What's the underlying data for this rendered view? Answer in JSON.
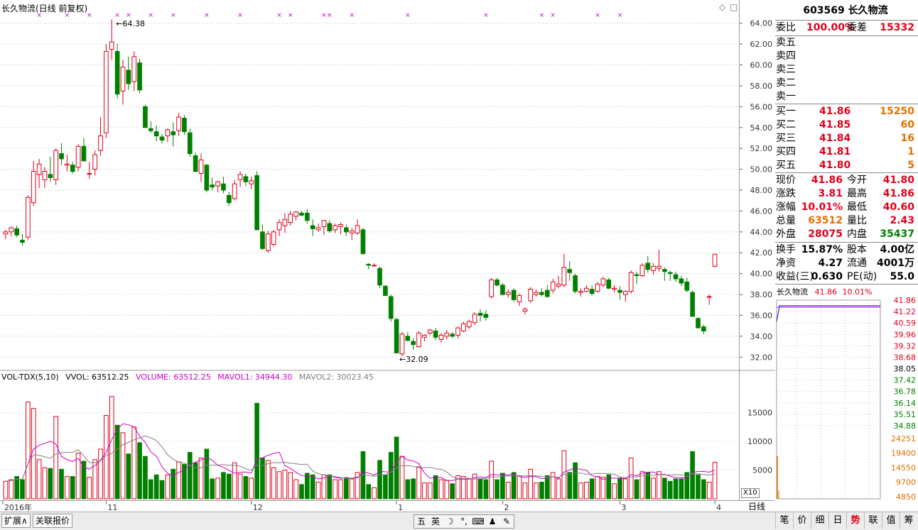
{
  "chart_title": "长久物流(日线 前复权)",
  "price_axis_labels": [
    "64.00",
    "62.00",
    "60.00",
    "58.00",
    "56.00",
    "54.00",
    "52.00",
    "50.00",
    "48.00",
    "46.00",
    "44.00",
    "42.00",
    "40.00",
    "38.00",
    "36.00",
    "34.00",
    "32.00"
  ],
  "vol_axis_labels": [
    "15000",
    "10000",
    "5000"
  ],
  "vol_header": {
    "name": "VOL-TDX(5,10)",
    "vvol": "VVOL: 63512.25",
    "volume": "VOLUME: 63512.25",
    "mavol1": "MAVOL1: 34944.30",
    "mavol2": "MAVOL2: 30023.45"
  },
  "vol_scale_label": "X10",
  "date_labels": [
    "2016年",
    "11",
    "12",
    "1",
    "2",
    "3",
    "4"
  ],
  "period_label": "日线",
  "annotations": {
    "high": "64.38",
    "low": "32.09"
  },
  "colors": {
    "up": "#e0001a",
    "down": "#008000",
    "ma1": "#cc00cc",
    "ma2": "#808080",
    "marker": "#cc00cc"
  },
  "chart_data": {
    "type": "candlestick",
    "title": "长久物流(日线 前复权)",
    "ylim": [
      31,
      65
    ],
    "candles": [
      [
        43.8,
        44.2,
        43.3,
        44.0
      ],
      [
        44.0,
        44.5,
        43.6,
        44.4
      ],
      [
        44.3,
        44.6,
        43.5,
        43.7
      ],
      [
        43.2,
        43.8,
        42.7,
        43.0
      ],
      [
        43.5,
        47.5,
        43.2,
        47.3
      ],
      [
        46.8,
        50.8,
        46.5,
        49.8
      ],
      [
        49.5,
        51.0,
        48.2,
        50.5
      ],
      [
        49.0,
        50.2,
        48.2,
        49.8
      ],
      [
        49.5,
        51.2,
        48.8,
        49.2
      ],
      [
        49.0,
        52.0,
        48.5,
        51.8
      ],
      [
        51.5,
        52.5,
        50.4,
        51.0
      ],
      [
        50.4,
        51.4,
        49.8,
        50.5
      ],
      [
        50.4,
        50.7,
        49.6,
        49.8
      ],
      [
        50.2,
        52.4,
        49.8,
        52.2
      ],
      [
        52.2,
        53.0,
        50.8,
        50.8
      ],
      [
        49.6,
        50.7,
        49.1,
        49.6
      ],
      [
        50.0,
        51.8,
        49.4,
        51.4
      ],
      [
        51.8,
        55.0,
        51.3,
        53.2
      ],
      [
        53.5,
        62.0,
        53.0,
        61.3
      ],
      [
        61.5,
        64.38,
        60.5,
        62.2
      ],
      [
        61.3,
        62.0,
        56.8,
        57.2
      ],
      [
        57.5,
        60.5,
        56.2,
        59.8
      ],
      [
        59.5,
        60.8,
        57.6,
        58.2
      ],
      [
        58.4,
        61.3,
        57.5,
        60.8
      ],
      [
        60.2,
        60.6,
        57.3,
        57.6
      ],
      [
        56.0,
        56.2,
        54.0,
        54.0
      ],
      [
        53.9,
        54.6,
        53.5,
        53.7
      ],
      [
        53.6,
        54.2,
        52.7,
        53.2
      ],
      [
        53.1,
        53.4,
        52.5,
        52.8
      ],
      [
        53.2,
        53.9,
        52.6,
        53.8
      ],
      [
        53.6,
        54.5,
        52.2,
        53.3
      ],
      [
        53.7,
        55.4,
        53.2,
        55.0
      ],
      [
        54.9,
        55.2,
        53.3,
        53.6
      ],
      [
        53.5,
        53.9,
        51.2,
        51.5
      ],
      [
        51.3,
        51.6,
        49.7,
        49.8
      ],
      [
        49.6,
        51.5,
        48.8,
        50.9
      ],
      [
        50.4,
        50.5,
        47.8,
        48.0
      ],
      [
        48.5,
        49.2,
        48.0,
        48.3
      ],
      [
        48.4,
        48.9,
        47.8,
        48.8
      ],
      [
        48.6,
        49.3,
        47.7,
        48.0
      ],
      [
        47.5,
        47.8,
        46.5,
        46.8
      ],
      [
        47.2,
        49.0,
        47.0,
        48.6
      ],
      [
        49.0,
        49.8,
        48.3,
        49.5
      ],
      [
        49.3,
        49.6,
        48.4,
        48.8
      ],
      [
        48.6,
        49.3,
        48.1,
        48.9
      ],
      [
        49.4,
        49.8,
        44.2,
        44.2
      ],
      [
        44.0,
        44.7,
        42.3,
        42.4
      ],
      [
        42.2,
        44.1,
        42.0,
        43.8
      ],
      [
        42.8,
        44.2,
        42.6,
        44.0
      ],
      [
        44.2,
        45.2,
        43.6,
        44.9
      ],
      [
        44.6,
        45.8,
        43.9,
        45.2
      ],
      [
        44.9,
        46.0,
        44.6,
        45.7
      ],
      [
        45.5,
        46.0,
        45.1,
        45.9
      ],
      [
        45.8,
        46.0,
        45.5,
        45.6
      ],
      [
        45.8,
        46.2,
        44.8,
        45.1
      ],
      [
        44.6,
        45.2,
        43.6,
        44.3
      ],
      [
        44.2,
        44.8,
        44.0,
        44.4
      ],
      [
        44.5,
        45.0,
        43.7,
        45.1
      ],
      [
        44.8,
        45.1,
        43.9,
        44.1
      ],
      [
        44.2,
        44.8,
        43.9,
        44.6
      ],
      [
        44.5,
        44.9,
        43.8,
        44.7
      ],
      [
        44.4,
        44.7,
        43.6,
        44.0
      ],
      [
        43.9,
        44.4,
        43.2,
        44.1
      ],
      [
        43.9,
        45.2,
        43.7,
        44.6
      ],
      [
        44.2,
        44.4,
        41.9,
        41.9
      ],
      [
        40.9,
        41.0,
        40.4,
        40.8
      ],
      [
        40.8,
        41.0,
        40.7,
        40.8
      ],
      [
        40.5,
        40.7,
        38.6,
        38.9
      ],
      [
        38.8,
        38.9,
        37.9,
        37.9
      ],
      [
        37.8,
        38.0,
        35.4,
        35.7
      ],
      [
        35.6,
        35.8,
        32.4,
        32.4
      ],
      [
        32.3,
        34.4,
        32.09,
        34.2
      ],
      [
        34.0,
        34.4,
        33.5,
        33.6
      ],
      [
        33.5,
        33.8,
        32.7,
        33.2
      ],
      [
        33.0,
        34.5,
        32.9,
        34.3
      ],
      [
        33.9,
        34.2,
        33.5,
        34.1
      ],
      [
        34.3,
        34.7,
        34.1,
        34.6
      ],
      [
        34.5,
        34.8,
        33.6,
        33.9
      ],
      [
        33.7,
        34.3,
        33.4,
        34.1
      ],
      [
        34.0,
        34.6,
        33.7,
        34.3
      ],
      [
        34.2,
        34.4,
        33.8,
        34.0
      ],
      [
        34.1,
        34.9,
        33.8,
        34.8
      ],
      [
        34.5,
        35.4,
        34.4,
        35.2
      ],
      [
        34.9,
        35.6,
        34.7,
        35.4
      ],
      [
        35.3,
        36.3,
        35.1,
        36.1
      ],
      [
        36.2,
        36.6,
        35.4,
        36.0
      ],
      [
        36.1,
        36.5,
        35.5,
        35.8
      ],
      [
        37.8,
        39.6,
        37.6,
        39.4
      ],
      [
        39.4,
        39.6,
        38.8,
        38.9
      ],
      [
        38.9,
        39.1,
        37.9,
        38.0
      ],
      [
        38.0,
        38.5,
        37.7,
        38.2
      ],
      [
        38.4,
        38.6,
        37.3,
        37.5
      ],
      [
        37.3,
        38.1,
        36.9,
        37.9
      ],
      [
        36.4,
        36.8,
        36.1,
        36.6
      ],
      [
        37.4,
        38.7,
        37.2,
        38.5
      ],
      [
        38.0,
        38.5,
        37.8,
        38.2
      ],
      [
        38.2,
        38.6,
        37.8,
        38.0
      ],
      [
        38.4,
        38.9,
        37.7,
        37.8
      ],
      [
        38.4,
        39.5,
        38.1,
        39.2
      ],
      [
        38.8,
        39.8,
        38.6,
        39.0
      ],
      [
        38.9,
        41.9,
        38.7,
        40.6
      ],
      [
        40.4,
        41.2,
        39.3,
        40.1
      ],
      [
        39.8,
        40.0,
        38.1,
        38.3
      ],
      [
        38.2,
        38.6,
        37.8,
        38.3
      ],
      [
        38.3,
        38.9,
        38.2,
        38.6
      ],
      [
        38.5,
        38.9,
        37.9,
        38.1
      ],
      [
        38.3,
        39.2,
        38.2,
        39.0
      ],
      [
        38.9,
        39.7,
        38.7,
        39.5
      ],
      [
        39.4,
        39.6,
        38.5,
        38.6
      ],
      [
        38.5,
        38.9,
        38.2,
        38.6
      ],
      [
        38.4,
        38.8,
        37.5,
        38.2
      ],
      [
        38.0,
        38.4,
        37.3,
        38.3
      ],
      [
        38.3,
        40.3,
        38.1,
        40.1
      ],
      [
        39.9,
        40.2,
        39.0,
        39.8
      ],
      [
        39.8,
        41.0,
        39.7,
        40.8
      ],
      [
        41.0,
        41.7,
        40.1,
        40.4
      ],
      [
        40.3,
        41.0,
        39.9,
        40.7
      ],
      [
        40.5,
        42.3,
        40.2,
        40.7
      ],
      [
        40.4,
        40.6,
        39.3,
        40.2
      ],
      [
        40.1,
        40.3,
        39.3,
        40.0
      ],
      [
        39.9,
        40.2,
        39.2,
        39.5
      ],
      [
        39.5,
        39.8,
        38.8,
        39.1
      ],
      [
        39.2,
        39.6,
        38.2,
        38.4
      ],
      [
        38.2,
        38.4,
        35.9,
        35.9
      ],
      [
        35.7,
        35.8,
        34.8,
        34.8
      ],
      [
        34.9,
        35.1,
        34.2,
        34.5
      ],
      [
        37.8,
        38.0,
        37.0,
        37.8
      ],
      [
        40.7,
        41.86,
        40.6,
        41.86
      ]
    ]
  },
  "quote": {
    "code_name": "603569 长久物流",
    "weibi_label": "委比",
    "weibi_value": "100.00%",
    "weicha_label": "委差",
    "weicha_value": "15332",
    "sells": [
      {
        "label": "卖五",
        "price": "",
        "vol": ""
      },
      {
        "label": "卖四",
        "price": "",
        "vol": ""
      },
      {
        "label": "卖三",
        "price": "",
        "vol": ""
      },
      {
        "label": "卖二",
        "price": "",
        "vol": ""
      },
      {
        "label": "卖一",
        "price": "",
        "vol": ""
      }
    ],
    "buys": [
      {
        "label": "买一",
        "price": "41.86",
        "vol": "15250"
      },
      {
        "label": "买二",
        "price": "41.85",
        "vol": "60"
      },
      {
        "label": "买三",
        "price": "41.84",
        "vol": "16"
      },
      {
        "label": "买四",
        "price": "41.81",
        "vol": "1"
      },
      {
        "label": "买五",
        "price": "41.80",
        "vol": "5"
      }
    ],
    "stats": [
      {
        "l1": "现价",
        "v1": "41.86",
        "c1": "red",
        "l2": "今开",
        "v2": "41.80",
        "c2": "red"
      },
      {
        "l1": "涨跌",
        "v1": "3.81",
        "c1": "red",
        "l2": "最高",
        "v2": "41.86",
        "c2": "red"
      },
      {
        "l1": "涨幅",
        "v1": "10.01%",
        "c1": "red",
        "l2": "最低",
        "v2": "40.60",
        "c2": "red"
      },
      {
        "l1": "总量",
        "v1": "63512",
        "c1": "orn",
        "l2": "量比",
        "v2": "2.43",
        "c2": "red"
      },
      {
        "l1": "外盘",
        "v1": "28075",
        "c1": "red",
        "l2": "内盘",
        "v2": "35437",
        "c2": "grn"
      }
    ],
    "stats2": [
      {
        "l1": "换手",
        "v1": "15.87%",
        "l2": "股本",
        "v2": "4.00亿"
      },
      {
        "l1": "净资",
        "v1": "4.27",
        "l2": "流通",
        "v2": "4001万"
      },
      {
        "l1": "收益(三)",
        "v1": "0.630",
        "l2": "PE(动)",
        "v2": "55.0"
      }
    ],
    "mini_title": "长久物流",
    "mini_price": "41.86",
    "mini_pct": "10.01%",
    "mini_price_labels": [
      "41.86",
      "41.22",
      "40.59",
      "39.96",
      "39.32",
      "38.68",
      "38.05",
      "37.42",
      "36.78",
      "36.14",
      "35.51",
      "34.88"
    ],
    "mini_vol_labels": [
      "24251",
      "19400",
      "14550",
      "9700",
      "4850"
    ]
  },
  "bottom": {
    "tab_expand": "扩展∧",
    "tab_related": "关联报价",
    "ime_items": [
      "五",
      "英",
      "☽",
      "°,",
      "⌨",
      "♟",
      "✎"
    ],
    "right_tabs": [
      "笔",
      "价",
      "细",
      "日",
      "势",
      "联",
      "值",
      "筹"
    ]
  }
}
